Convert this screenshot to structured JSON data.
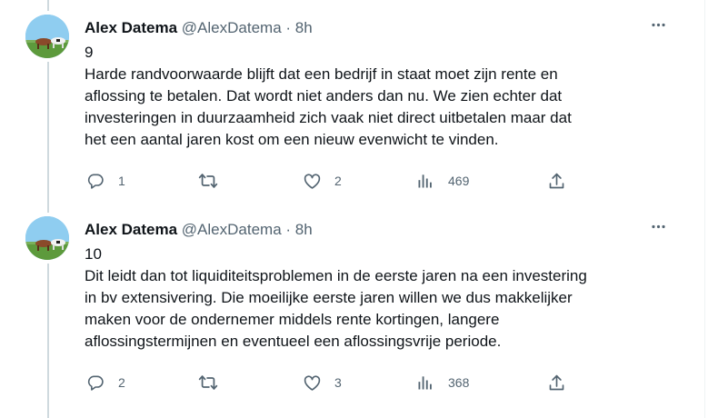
{
  "tweets": [
    {
      "author_name": "Alex Datema",
      "handle": "@AlexDatema",
      "separator": "·",
      "time": "8h",
      "index": "9",
      "text_lines": [
        "Harde randvoorwaarde blijft dat een bedrijf in staat moet zijn rente en",
        "aflossing te betalen. Dat wordt niet anders dan nu. We zien echter dat",
        "investeringen in duurzaamheid zich vaak niet direct uitbetalen maar dat",
        "het een aantal jaren kost om een nieuw evenwicht te vinden."
      ],
      "replies": "1",
      "retweets": "",
      "likes": "2",
      "views": "469"
    },
    {
      "author_name": "Alex Datema",
      "handle": "@AlexDatema",
      "separator": "·",
      "time": "8h",
      "index": "10",
      "text_lines": [
        "Dit leidt dan tot liquiditeitsproblemen in de eerste jaren na een investering",
        "in bv extensivering. Die moeilijke eerste jaren willen we dus makkelijker",
        "maken voor de ondernemer middels rente kortingen, langere",
        "aflossingstermijnen en eventueel een aflossingsvrije periode."
      ],
      "replies": "2",
      "retweets": "",
      "likes": "3",
      "views": "368"
    }
  ],
  "icons": {
    "more": "more-dots-icon",
    "reply": "reply-icon",
    "retweet": "retweet-icon",
    "like": "heart-icon",
    "views": "views-chart-icon",
    "share": "share-icon"
  },
  "colors": {
    "text": "#0f1419",
    "secondary": "#536471",
    "thread_line": "#cfd9de"
  }
}
